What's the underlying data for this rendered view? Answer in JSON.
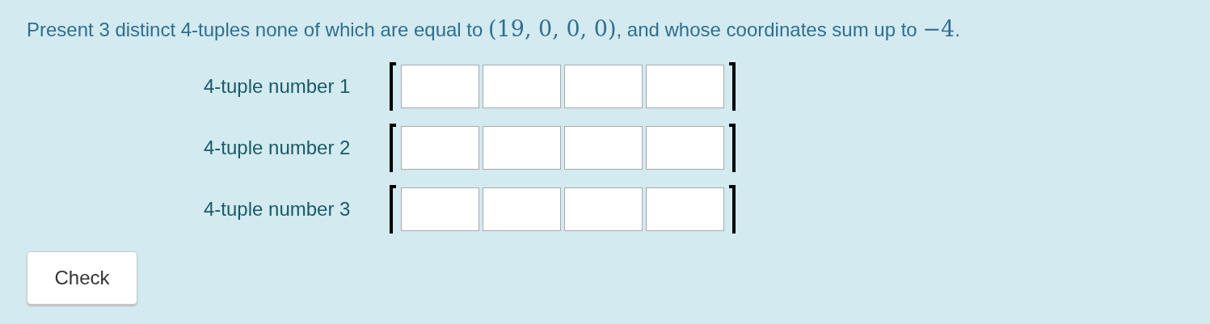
{
  "prompt": [
    {
      "kind": "text",
      "text": "Present 3 distinct 4-tuples none of which are equal to "
    },
    {
      "kind": "math",
      "text": "(19, 0, 0, 0)"
    },
    {
      "kind": "text",
      "text": ", and whose coordinates sum up to "
    },
    {
      "kind": "math",
      "text": "−4"
    },
    {
      "kind": "text",
      "text": "."
    }
  ],
  "tuples": [
    {
      "label": "4-tuple number 1",
      "fields": [
        {
          "kind": "entry"
        },
        {
          "kind": "entry"
        },
        {
          "kind": "entry"
        },
        {
          "kind": "entry"
        }
      ]
    },
    {
      "label": "4-tuple number 2",
      "fields": [
        {
          "kind": "entry"
        },
        {
          "kind": "entry"
        },
        {
          "kind": "entry"
        },
        {
          "kind": "entry"
        }
      ]
    },
    {
      "label": "4-tuple number 3",
      "fields": [
        {
          "kind": "entry"
        },
        {
          "kind": "entry"
        },
        {
          "kind": "entry"
        },
        {
          "kind": "entry"
        }
      ]
    }
  ],
  "button": {
    "label": "Check"
  }
}
